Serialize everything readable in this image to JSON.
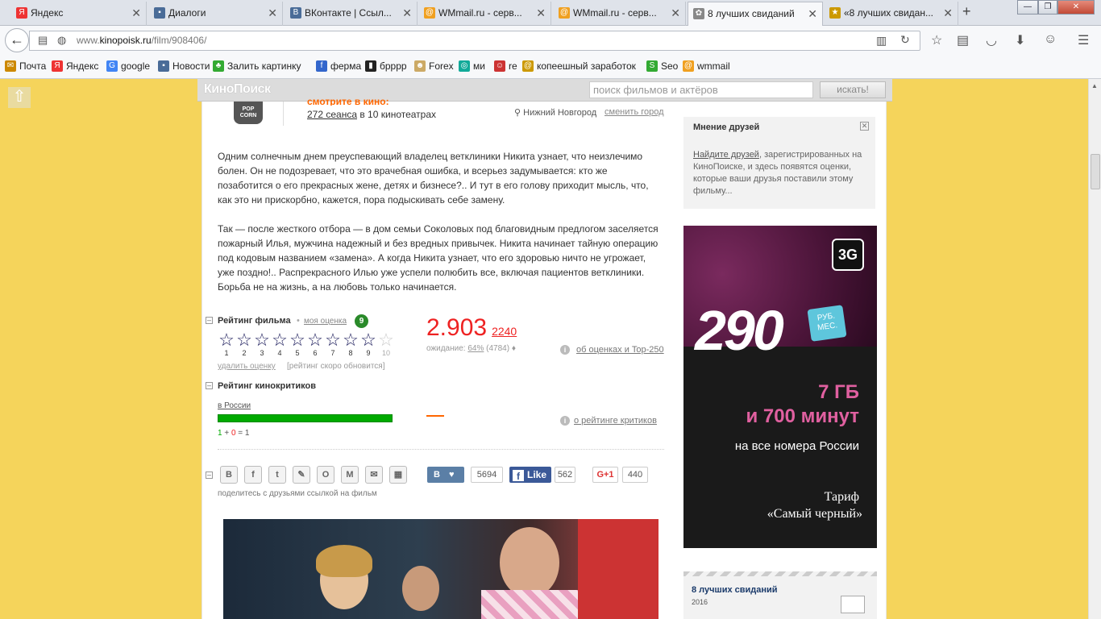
{
  "browser": {
    "tabs": [
      {
        "label": "Яндекс",
        "icon": "Я",
        "color": "#e33"
      },
      {
        "label": "Диалоги",
        "icon": "▪",
        "color": "#4a6c98"
      },
      {
        "label": "ВКонтакте | Ссыл...",
        "icon": "В",
        "color": "#4a6c98"
      },
      {
        "label": "WMmail.ru - серв...",
        "icon": "@",
        "color": "#f0a020"
      },
      {
        "label": "WMmail.ru - серв...",
        "icon": "@",
        "color": "#f0a020"
      },
      {
        "label": "8 лучших свиданий",
        "icon": "✿",
        "color": "#888"
      },
      {
        "label": "«8 лучших свидан...",
        "icon": "★",
        "color": "#c90"
      }
    ],
    "url_host": "www.",
    "url_domain": "kinopoisk.ru",
    "url_path": "/film/908406/",
    "bookmarks": [
      {
        "label": "Почта",
        "icon": "✉",
        "color": "#c80"
      },
      {
        "label": "Яндекс",
        "icon": "Я",
        "color": "#e33"
      },
      {
        "label": "google",
        "icon": "G",
        "color": "#4285f4"
      },
      {
        "label": "Новости",
        "icon": "▪",
        "color": "#4a6c98"
      },
      {
        "label": "Залить картинку",
        "icon": "♣",
        "color": "#3a3"
      },
      {
        "label": "ферма",
        "icon": "f",
        "color": "#36c"
      },
      {
        "label": "брррр",
        "icon": "▮",
        "color": "#222"
      },
      {
        "label": "Forex",
        "icon": "☻",
        "color": "#ca6"
      },
      {
        "label": "ми",
        "icon": "◎",
        "color": "#1a9"
      },
      {
        "label": "re",
        "icon": "☺",
        "color": "#c33"
      },
      {
        "label": "копеешный заработок",
        "icon": "@",
        "color": "#c90"
      },
      {
        "label": "Seo",
        "icon": "S",
        "color": "#3a3"
      },
      {
        "label": "wmmail",
        "icon": "@",
        "color": "#f0a020"
      }
    ]
  },
  "kp": {
    "logo": "КиноПоиск",
    "search_placeholder": "поиск фильмов и актёров",
    "search_button": "искать!"
  },
  "cinema": {
    "title": "смотрите в кино:",
    "sessions": "272 сеанса",
    "in": " в 10 кинотеатрах",
    "city": "Нижний Новгород",
    "change_city": "сменить город",
    "popcorn": "POP CORN"
  },
  "description": {
    "p1": "Одним солнечным днем преуспевающий владелец ветклиники Никита узнает, что неизлечимо болен. Он не подозревает, что это врачебная ошибка, и всерьез задумывается: кто же позаботится о его прекрасных жене, детях и бизнесе?.. И тут в его голову приходит мысль, что, как это ни прискорбно, кажется, пора подыскивать себе замену.",
    "p2": "Так — после жесткого отбора — в дом семьи Соколовых под благовидным предлогом заселяется пожарный Илья, мужчина надежный и без вредных привычек. Никита начинает тайную операцию под кодовым названием «замена». А когда Никита узнает, что его здоровью ничто не угрожает, уже поздно!.. Распрекрасного Илью уже успели полюбить все, включая пациентов ветклиники. Борьба не на жизнь, а на любовь только начинается."
  },
  "rating": {
    "title": "Рейтинг фильма",
    "my_rating_link": "моя оценка",
    "my_rating": "9",
    "star_numbers": [
      "1",
      "2",
      "3",
      "4",
      "5",
      "6",
      "7",
      "8",
      "9",
      "10"
    ],
    "filled_stars": 9,
    "delete": "удалить оценку",
    "soon": "[рейтинг скоро обновится]",
    "score": "2.903",
    "votes": "2240",
    "expect_label": "ожидание: ",
    "expect_pct": "64%",
    "expect_count": " (4784) ",
    "about_link": "об оценках и Top-250"
  },
  "critics": {
    "title": "Рейтинг кинокритиков",
    "russia": "в России",
    "pos": "1",
    "plus": " + ",
    "neg": "0",
    "eq": " = 1",
    "about_link": "о рейтинге критиков"
  },
  "share": {
    "icons": [
      "В",
      "f",
      "t",
      "✎",
      "О",
      "М",
      "✉",
      "▦"
    ],
    "icon_names": [
      "vk-share-icon",
      "facebook-share-icon",
      "twitter-share-icon",
      "livejournal-share-icon",
      "odnoklassniki-share-icon",
      "mailru-share-icon",
      "email-share-icon",
      "qr-code-icon"
    ],
    "text": "поделитесь с друзьями ссылкой на фильм",
    "vk_count": "5694",
    "fb_label": "Like",
    "fb_count": "562",
    "g_label": "G+1",
    "g_count": "440"
  },
  "friends": {
    "title": "Мнение друзей",
    "link": "Найдите друзей",
    "text": ", зарегистрированных на КиноПоиске, и здесь появятся оценки, которые ваши друзья поставили этому фильму..."
  },
  "ad": {
    "badge": "3G",
    "price": "290",
    "unit_line1": "РУБ.",
    "unit_line2": "МЕС.",
    "gb": "7 ГБ",
    "minutes": "и 700 минут",
    "all": "на все номера России",
    "tarif": "Тариф",
    "tarif_name": "«Самый черный»"
  },
  "filmcard": {
    "title": "8 лучших свиданий",
    "year": "2016"
  }
}
